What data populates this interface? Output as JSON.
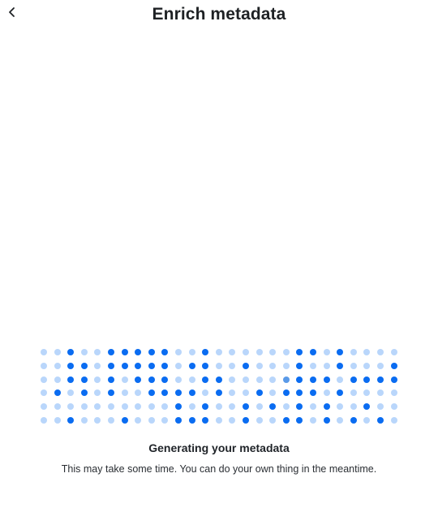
{
  "header": {
    "title": "Enrich metadata",
    "back_icon": "chevron-left-icon"
  },
  "loader": {
    "colors": {
      "light": "#b9d6fb",
      "dark": "#0a6cf1",
      "mid": "#5a9ae8"
    },
    "rows": [
      "LLDLLDDDDDLLDLLLLLLDDLDLLLL",
      "LLDDLDDDDDLDDLLDLLLDLLDLLLD",
      "LLDDLDLDDDLLDDLLLLMDDDLDDDD",
      "LDLDLDLLDDDDLDLLDLDDDLDLLLL",
      "LLLLLLLLLLDLDLLDLDLDLDLLDLL",
      "LLDLLLDLLLDDDLLDLLDDLDLDLDL"
    ],
    "status_title": "Generating your metadata",
    "status_subtitle": "This may take some time. You can do your own thing in the meantime."
  }
}
